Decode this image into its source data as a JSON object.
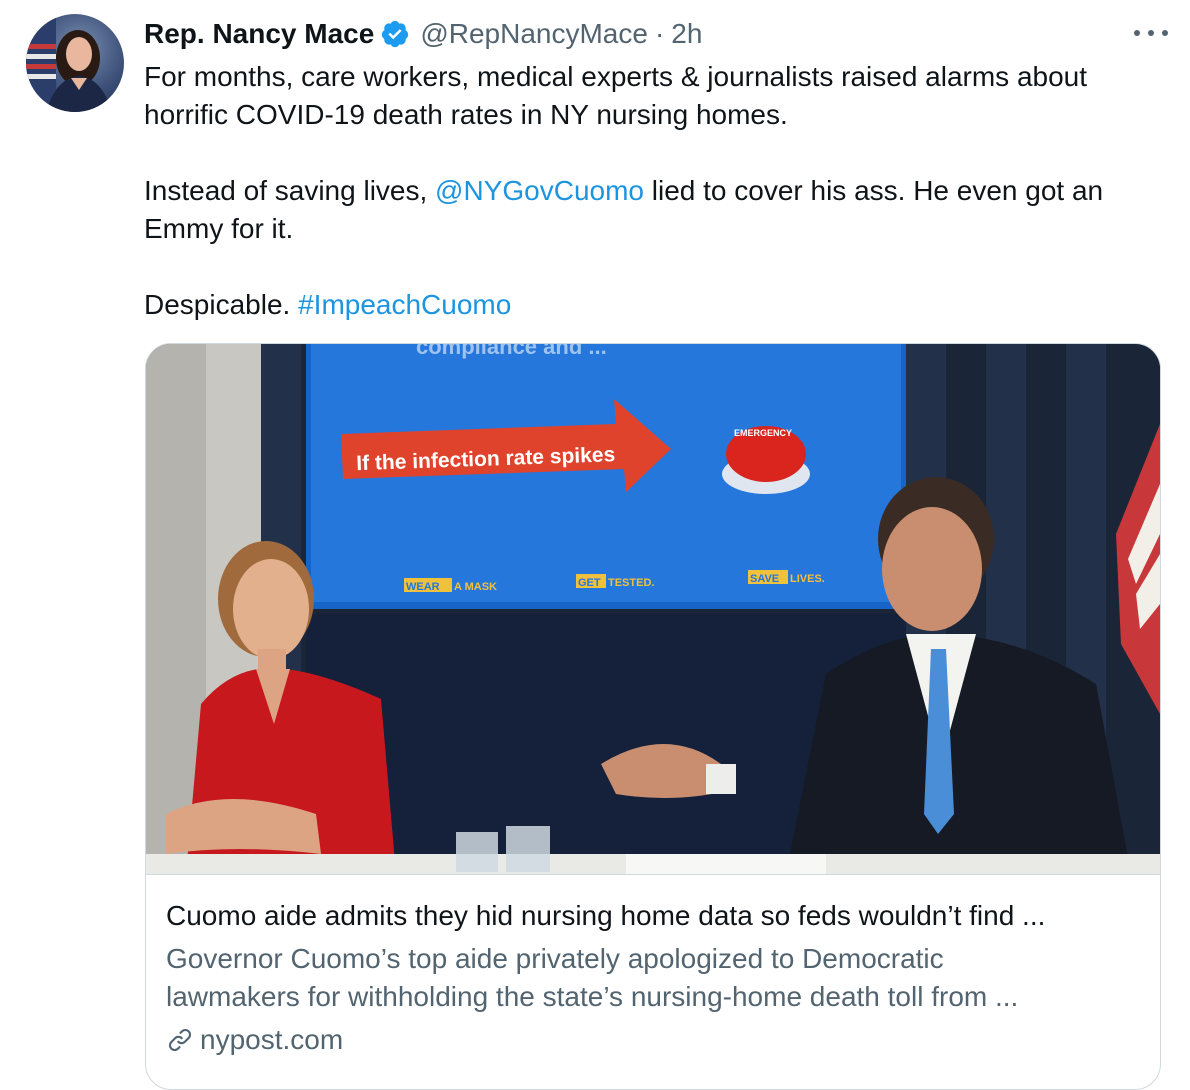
{
  "tweet": {
    "author_name": "Rep. Nancy Mace",
    "handle": "@RepNancyMace",
    "separator": "·",
    "time": "2h",
    "paragraph1": "For months, care workers, medical experts & journalists raised alarms about horrific COVID-19 death rates in NY nursing homes.",
    "paragraph2_before": "Instead of saving lives, ",
    "paragraph2_mention": "@NYGovCuomo",
    "paragraph2_after": " lied to cover his ass. He even got an Emmy for it.",
    "paragraph3_before": "Despicable. ",
    "paragraph3_hashtag": "#ImpeachCuomo"
  },
  "card": {
    "title": "Cuomo aide admits they hid nursing home data so feds wouldn’t find ...",
    "description_line1": "Governor Cuomo’s top aide privately apologized to Democratic",
    "description_line2": "lawmakers for withholding the state’s nursing-home death toll from ...",
    "domain": "nypost.com",
    "image": {
      "screen_banner": "If the infection rate spikes",
      "screen_top_fragment": "compliance and ...",
      "emergency_button_label": "EMERGENCY",
      "slogan_1_highlight": "WEAR",
      "slogan_1_rest": "A MASK",
      "slogan_2_highlight": "GET",
      "slogan_2_rest": "TESTED.",
      "slogan_3_highlight": "SAVE",
      "slogan_3_rest": "LIVES."
    }
  },
  "icons": {
    "verified": "verified-badge-icon",
    "more": "more-options-icon",
    "link": "link-icon"
  },
  "colors": {
    "link_blue": "#1b95e0",
    "verified_blue": "#1d9bf0",
    "muted_gray": "#536471",
    "border": "#cfd9de"
  }
}
